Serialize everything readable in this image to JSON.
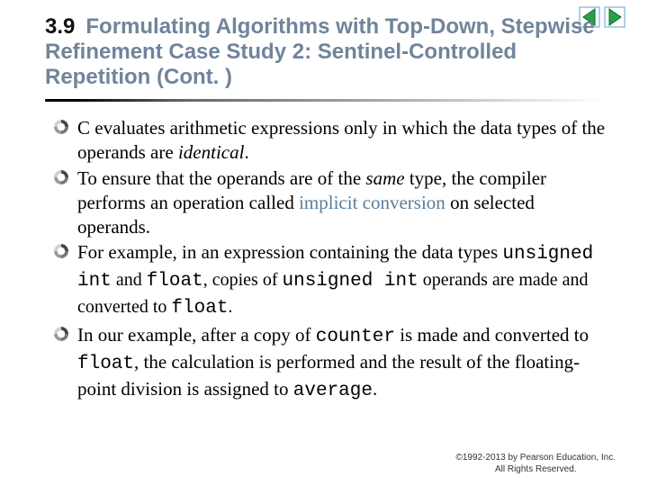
{
  "nav": {
    "prev_alt": "previous",
    "next_alt": "next"
  },
  "title": {
    "number": "3.9",
    "text": "Formulating Algorithms with Top-Down, Stepwise Refinement Case Study 2: Sentinel-Controlled Repetition (Cont. )"
  },
  "bullets": {
    "b1_a": "C evaluates arithmetic expressions only in which the data types of the operands are ",
    "b1_it": "identical",
    "b1_b": ".",
    "b2_a": "To ensure that the operands are of the ",
    "b2_it": "same",
    "b2_b": " type, the compiler performs an operation called ",
    "b2_kw": "implicit conversion",
    "b2_c": " on selected operands.",
    "b3_a": "For example, in an expression containing the data types ",
    "b3_code1": "unsigned int",
    "b3_mid": " and ",
    "b3_code2": "float",
    "b3_b": ", copies of ",
    "b3_code3": "unsigned int",
    "b3_c": " operands are made and converted to ",
    "b3_code4": "float",
    "b3_d": ".",
    "b4_a": "In our example, after a copy of ",
    "b4_code1": "counter",
    "b4_b": " is made and converted to ",
    "b4_code2": "float",
    "b4_c": ", the calculation is performed and the result of the floating-point division is assigned to ",
    "b4_code3": "average",
    "b4_d": "."
  },
  "footer": {
    "line1": "©1992-2013 by Pearson Education, Inc.",
    "line2": "All Rights Reserved."
  }
}
